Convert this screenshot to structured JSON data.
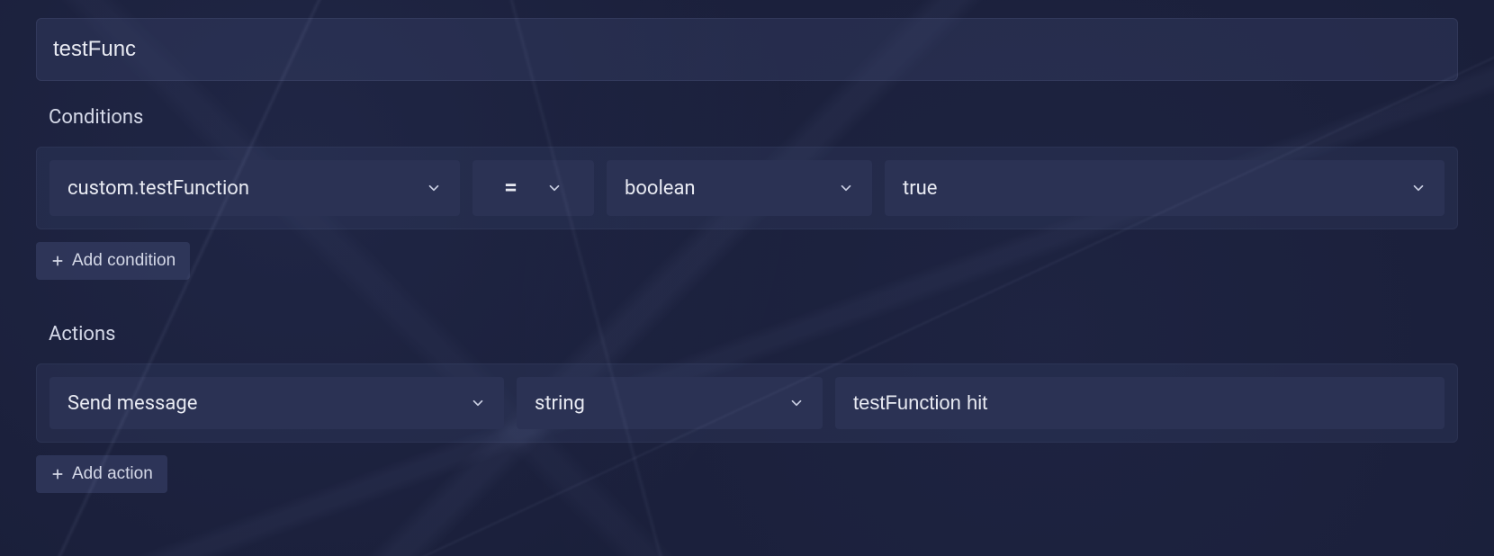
{
  "title": "testFunc",
  "sections": {
    "conditions": {
      "heading": "Conditions",
      "rows": [
        {
          "field": "custom.testFunction",
          "operator": "=",
          "valueType": "boolean",
          "value": "true"
        }
      ],
      "addLabel": "Add condition"
    },
    "actions": {
      "heading": "Actions",
      "rows": [
        {
          "actionType": "Send message",
          "valueType": "string",
          "value": "testFunction hit"
        }
      ],
      "addLabel": "Add action"
    }
  }
}
